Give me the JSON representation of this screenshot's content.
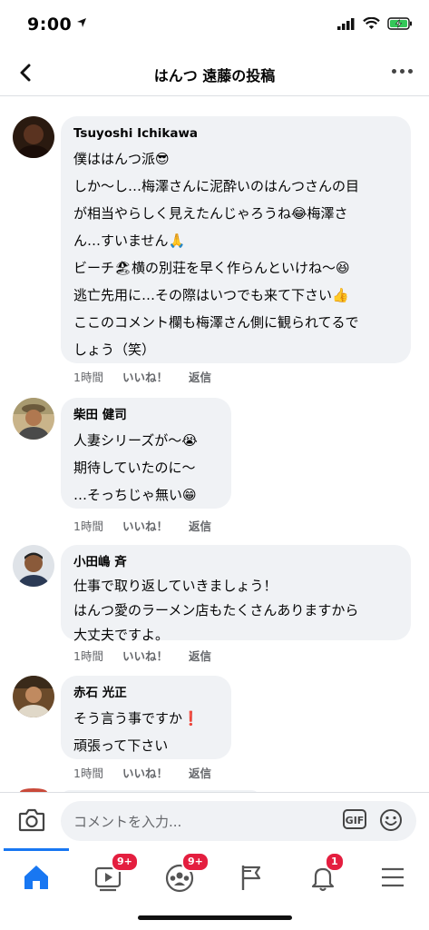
{
  "status": {
    "time": "9:00"
  },
  "header": {
    "title": "はんつ 遠藤の投稿"
  },
  "comments": [
    {
      "author": "Tsuyoshi Ichikawa",
      "lines": [
        "僕ははんつ派😎",
        "しか〜し…梅澤さんに泥酔いのはんつさんの目",
        "が相当やらしく見えたんじゃろうね😂梅澤さ",
        "ん…すいません🙏",
        "ビーチ🏖横の別荘を早く作らんといけね〜😆",
        "逃亡先用に…その際はいつでも来て下さい👍",
        "ここのコメント欄も梅澤さん側に観られてるで",
        "しょう（笑）"
      ],
      "time": "1時間",
      "like": "いいね！",
      "reply": "返信"
    },
    {
      "author": "柴田 健司",
      "lines": [
        "人妻シリーズが〜😭",
        "期待していたのに〜",
        "…そっちじゃ無い😁"
      ],
      "time": "1時間",
      "like": "いいね！",
      "reply": "返信"
    },
    {
      "author": "小田嶋 斉",
      "lines": [
        "仕事で取り返していきましょう！",
        "はんつ愛のラーメン店もたくさんありますから",
        "大丈夫ですよ。"
      ],
      "time": "1時間",
      "like": "いいね！",
      "reply": "返信"
    },
    {
      "author": "赤石 光正",
      "lines": [
        "そう言う事ですか❗",
        "頑張って下さい"
      ],
      "time": "1時間",
      "like": "いいね！",
      "reply": "返信"
    }
  ],
  "composer": {
    "placeholder": "コメントを入力...",
    "gif": "GIF"
  },
  "tabbar": {
    "items": [
      {
        "name": "home",
        "icon": "home-icon",
        "active": true
      },
      {
        "name": "watch",
        "icon": "video-icon",
        "badge": "9+"
      },
      {
        "name": "groups",
        "icon": "groups-icon",
        "badge": "9+"
      },
      {
        "name": "pages",
        "icon": "flag-icon"
      },
      {
        "name": "notifications",
        "icon": "bell-icon",
        "badge": "1"
      },
      {
        "name": "menu",
        "icon": "hamburger-icon"
      }
    ]
  },
  "colors": {
    "accent": "#1877f2",
    "badge": "#e41e3f",
    "bubble": "#f0f2f5",
    "meta": "#65676b"
  }
}
